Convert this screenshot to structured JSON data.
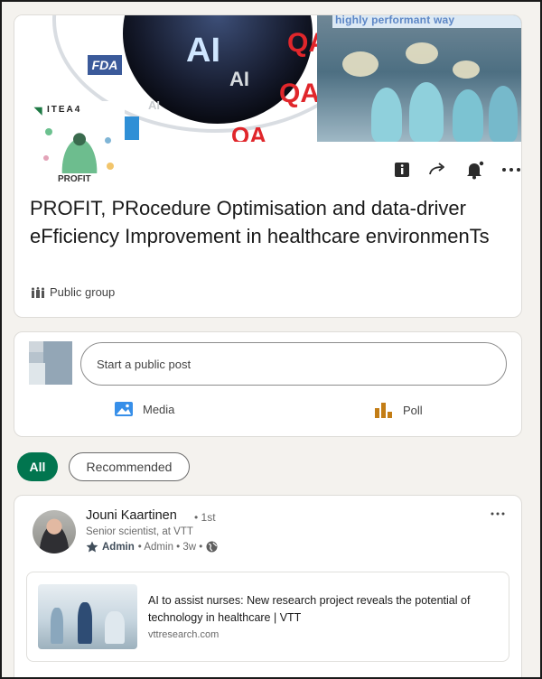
{
  "group": {
    "cover": {
      "strip_text": "highly performant way",
      "ai_big": "AI",
      "ai_small": "AI",
      "ai_tiny": "AI",
      "fda": "FDA",
      "qa_labels": [
        "QA",
        "QA",
        "QA"
      ]
    },
    "logo": {
      "itea": "ITEA4",
      "name": "PROFIT"
    },
    "actions": {
      "info_icon": "info-icon",
      "share_icon": "share-arrow-icon",
      "notifications_icon": "bell-icon",
      "more_icon": "more-icon"
    },
    "title": "PROFIT, PRocedure Optimisation and data-driver eFficiency Improvement in healthcare environmenTs",
    "type": "Public group"
  },
  "composer": {
    "placeholder": "Start a public post",
    "media_label": "Media",
    "poll_label": "Poll"
  },
  "filters": {
    "all": "All",
    "recommended": "Recommended"
  },
  "post": {
    "author_name": "Jouni Kaartinen",
    "degree": "• 1st",
    "role": "Senior scientist, at VTT",
    "badge": "Admin",
    "meta": "• Admin • 3w •",
    "link": {
      "title": "AI to assist nurses: New research project reveals the potential of technology in healthcare | VTT",
      "domain": "vttresearch.com"
    }
  },
  "colors": {
    "accent_green": "#01754f",
    "media_blue": "#378fe9",
    "poll_orange": "#c37d16",
    "qa_red": "#e0262b"
  }
}
